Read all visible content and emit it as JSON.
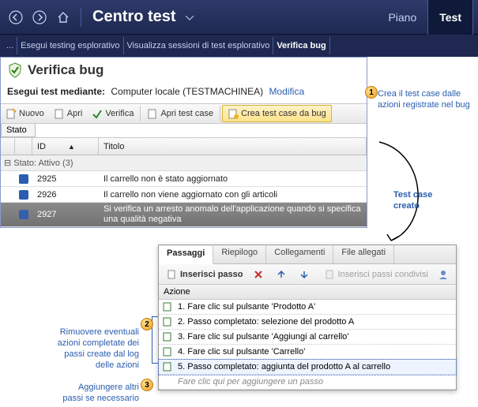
{
  "header": {
    "title": "Centro test",
    "tabs": {
      "piano": "Piano",
      "test": "Test"
    }
  },
  "subnav": {
    "ellipsis": "...",
    "items": [
      "Esegui testing esplorativo",
      "Visualizza sessioni di test esplorativo",
      "Verifica bug"
    ]
  },
  "pane": {
    "title": "Verifica bug",
    "run_label": "Esegui test mediante:",
    "run_value": "Computer locale (TESTMACHINEA)",
    "modify_link": "Modifica"
  },
  "toolbar": {
    "nuovo": "Nuovo",
    "apri": "Apri",
    "verifica": "Verifica",
    "apri_tc": "Apri test case",
    "crea_tc": "Crea test case da bug"
  },
  "stato_label": "Stato",
  "grid": {
    "col_id": "ID",
    "col_title": "Titolo",
    "group_text": "Stato: Attivo (3)",
    "rows": [
      {
        "id": "2925",
        "title": "Il carrello non è stato aggiornato"
      },
      {
        "id": "2926",
        "title": "Il carrello non viene aggiornato con gli articoli"
      },
      {
        "id": "2927",
        "title": "Si verifica un arresto anomalo dell'applicazione quando si specifica una qualità negativa"
      }
    ]
  },
  "float": {
    "tabs": {
      "passaggi": "Passaggi",
      "riepilogo": "Riepilogo",
      "collegamenti": "Collegamenti",
      "allegati": "File allegati"
    },
    "insert_step": "Inserisci passo",
    "insert_shared": "Inserisci passi condivisi",
    "col_action": "Azione",
    "steps": [
      "1. Fare clic sul pulsante 'Prodotto A'",
      "2. Passo completato: selezione del prodotto A",
      "3. Fare clic sul pulsante 'Aggiungi al carrello'",
      "4. Fare clic sul pulsante 'Carrello'",
      "5. Passo completato: aggiunta del prodotto A al carrello"
    ],
    "placeholder": "Fare clic qui per aggiungere un passo"
  },
  "callouts": {
    "c1": "Crea il test case dalle azioni registrate nel bug",
    "arrow_label": "Test case creato",
    "c2": "Rimuovere eventuali azioni completate dei passi create dal log delle azioni",
    "c3": "Aggiungere altri passi se necessario"
  }
}
